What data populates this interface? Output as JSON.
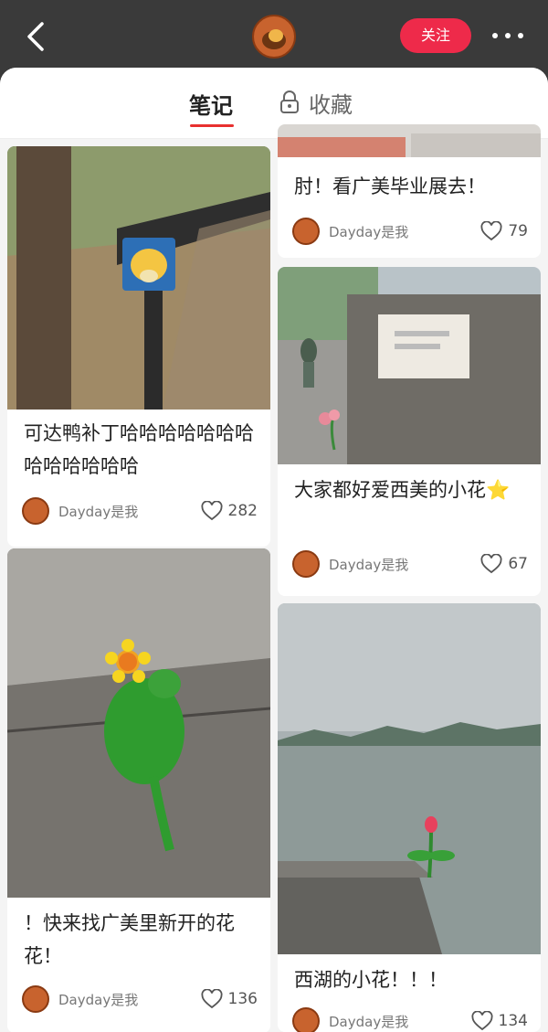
{
  "header": {
    "back_icon": "chevron-left-icon",
    "follow_label": "关注",
    "more_label": "•••"
  },
  "tabs": {
    "notes_label": "笔记",
    "favorites_label": "收藏",
    "favorites_icon": "lock-icon"
  },
  "cards": [
    {
      "title": "可达鸭补丁哈哈哈哈哈哈哈哈哈哈哈哈哈",
      "author": "Dayday是我",
      "likes": "282"
    },
    {
      "title": "！快来找广美里新开的花花！",
      "author": "Dayday是我",
      "likes": "136"
    },
    {
      "title": "肘！看广美毕业展去！",
      "author": "Dayday是我",
      "likes": "79"
    },
    {
      "title": "大家都好爱西美的小花⭐",
      "author": "Dayday是我",
      "likes": "67"
    },
    {
      "title": "西湖的小花！！！",
      "author": "Dayday是我",
      "likes": "134"
    }
  ],
  "colors": {
    "accent": "#ee2a4a",
    "tab_underline": "#e8302f"
  }
}
